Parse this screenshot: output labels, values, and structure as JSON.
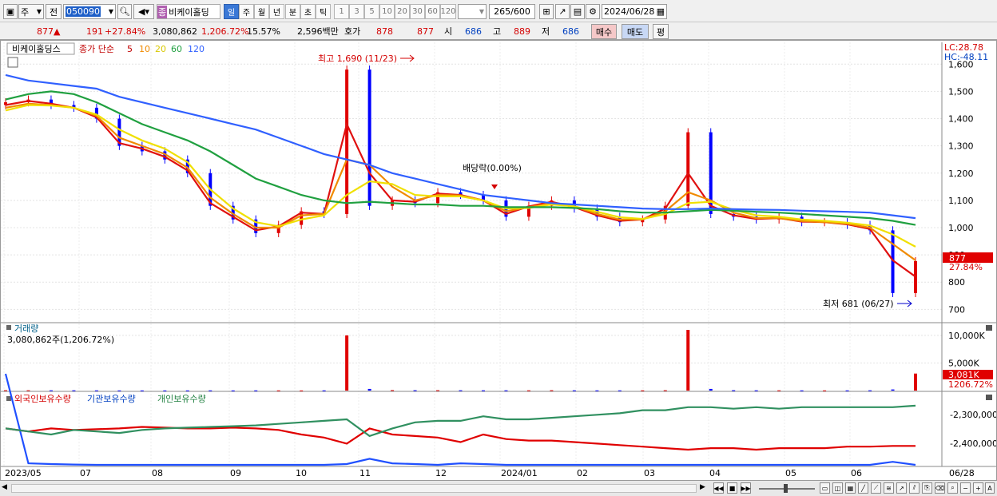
{
  "toolbar": {
    "period_combo": "주",
    "prev_label": "전",
    "code": "050090",
    "search_icon": "search-icon",
    "jong": "종",
    "stock_name": "비케이홀딩",
    "periods": [
      "일",
      "주",
      "월",
      "년",
      "분",
      "초",
      "틱"
    ],
    "minutes": [
      "1",
      "3",
      "5",
      "10",
      "20",
      "30",
      "60",
      "120"
    ],
    "count": "265",
    "count_total": "/600",
    "date": "2024/06/28"
  },
  "quote": {
    "price": "877",
    "arrow": "▲",
    "change": "191",
    "change_pct": "+27.84%",
    "volume": "3,080,862",
    "volume_pct": "1,206.72%",
    "turnover": "15.57%",
    "amount": "2,596백만",
    "hoga_label": "호가",
    "ask": "878",
    "bid": "877",
    "open_label": "시",
    "open": "686",
    "high_label": "고",
    "high": "889",
    "low_label": "저",
    "low": "686",
    "buy": "매수",
    "sell": "매도",
    "eval": "평"
  },
  "price_panel": {
    "name": "비케이홀딩스",
    "ma_label": "종가 단순",
    "ma_periods": [
      "5",
      "10",
      "20",
      "60",
      "120"
    ],
    "lc": "LC:28.78",
    "hc": "HC:-48.11",
    "high_note": "최고 1,690 (11/23)",
    "low_note": "최저 681 (06/27)",
    "dividend_note": "배당락(0.00%)",
    "last_price": "877",
    "last_pct": "27.84%"
  },
  "volume_panel": {
    "title": "거래량",
    "value": "3,080,862주(1,206.72%)",
    "last": "3,081K",
    "last_pct": "1206.72%"
  },
  "holdings_panel": {
    "foreign": "외국인보유수량",
    "institution": "기관보유수량",
    "individual": "개인보유수량"
  },
  "colors": {
    "up": "#e00000",
    "down": "#0000ff",
    "ma5": "#e01010",
    "ma10": "#f08a00",
    "ma20": "#f0e000",
    "ma60": "#20a040",
    "ma120": "#3060ff"
  },
  "chart_data": [
    {
      "type": "line",
      "title": "비케이홀딩스",
      "x_ticks": [
        "2023/05",
        "07",
        "08",
        "09",
        "10",
        "11",
        "12",
        "2024/01",
        "02",
        "03",
        "04",
        "05",
        "06",
        "06/28"
      ],
      "y_ticks": [
        1600,
        1500,
        1400,
        1300,
        1200,
        1100,
        1000,
        900,
        800,
        700
      ],
      "ylim": [
        660,
        1680
      ],
      "series": [
        {
          "name": "종가",
          "values": [
            1460,
            1470,
            1450,
            1440,
            1400,
            1300,
            1280,
            1250,
            1200,
            1080,
            1030,
            980,
            1010,
            1060,
            1050,
            1580,
            1080,
            1100,
            1090,
            1130,
            1120,
            1100,
            1040,
            1080,
            1100,
            1070,
            1040,
            1020,
            1030,
            1080,
            1350,
            1050,
            1040,
            1030,
            1040,
            1020,
            1020,
            1010,
            990,
            760,
            877
          ]
        },
        {
          "name": "5",
          "values": [
            1450,
            1465,
            1455,
            1440,
            1405,
            1310,
            1290,
            1260,
            1210,
            1090,
            1040,
            990,
            1005,
            1055,
            1050,
            1380,
            1200,
            1100,
            1095,
            1125,
            1120,
            1100,
            1050,
            1078,
            1095,
            1075,
            1045,
            1025,
            1030,
            1070,
            1200,
            1080,
            1045,
            1032,
            1035,
            1022,
            1020,
            1012,
            995,
            880,
            820
          ]
        },
        {
          "name": "10",
          "values": [
            1440,
            1455,
            1450,
            1440,
            1410,
            1330,
            1300,
            1270,
            1220,
            1110,
            1050,
            1000,
            1000,
            1045,
            1050,
            1250,
            1230,
            1150,
            1100,
            1120,
            1118,
            1100,
            1060,
            1075,
            1090,
            1078,
            1050,
            1030,
            1030,
            1060,
            1130,
            1100,
            1055,
            1035,
            1035,
            1024,
            1020,
            1014,
            1000,
            940,
            880
          ]
        },
        {
          "name": "20",
          "values": [
            1430,
            1450,
            1448,
            1440,
            1415,
            1360,
            1320,
            1290,
            1240,
            1140,
            1070,
            1020,
            1005,
            1030,
            1045,
            1120,
            1170,
            1160,
            1120,
            1115,
            1115,
            1100,
            1070,
            1072,
            1085,
            1078,
            1058,
            1038,
            1032,
            1050,
            1090,
            1095,
            1065,
            1045,
            1040,
            1030,
            1025,
            1018,
            1008,
            975,
            930
          ]
        },
        {
          "name": "60",
          "values": [
            1470,
            1490,
            1500,
            1490,
            1460,
            1420,
            1380,
            1350,
            1320,
            1280,
            1230,
            1180,
            1150,
            1120,
            1100,
            1090,
            1095,
            1090,
            1085,
            1085,
            1080,
            1080,
            1075,
            1075,
            1075,
            1072,
            1068,
            1060,
            1055,
            1055,
            1060,
            1065,
            1062,
            1058,
            1055,
            1050,
            1045,
            1040,
            1035,
            1025,
            1010
          ]
        },
        {
          "name": "120",
          "values": [
            1560,
            1540,
            1530,
            1520,
            1510,
            1480,
            1460,
            1440,
            1420,
            1400,
            1380,
            1360,
            1330,
            1300,
            1270,
            1250,
            1230,
            1200,
            1180,
            1160,
            1140,
            1120,
            1110,
            1100,
            1090,
            1085,
            1080,
            1075,
            1070,
            1068,
            1068,
            1070,
            1068,
            1066,
            1065,
            1062,
            1060,
            1058,
            1055,
            1045,
            1035
          ]
        }
      ]
    },
    {
      "type": "bar",
      "title": "거래량",
      "y_ticks": [
        "10,000K",
        "5,000K"
      ],
      "ylim": [
        0,
        11000
      ],
      "values_k": [
        60,
        50,
        40,
        40,
        30,
        20,
        20,
        20,
        20,
        30,
        20,
        30,
        30,
        20,
        30,
        10000,
        300,
        80,
        60,
        60,
        50,
        40,
        40,
        40,
        60,
        40,
        30,
        30,
        40,
        60,
        11000,
        300,
        60,
        40,
        40,
        30,
        30,
        30,
        40,
        200,
        3081
      ]
    },
    {
      "type": "line",
      "title": "보유수량",
      "y_ticks": [
        "-2,300,000",
        "-2,400,000"
      ],
      "series": [
        {
          "name": "외국인보유수량",
          "values": [
            560,
            580,
            560,
            570,
            565,
            560,
            550,
            555,
            560,
            560,
            555,
            560,
            570,
            600,
            620,
            660,
            560,
            600,
            610,
            620,
            650,
            600,
            630,
            640,
            640,
            650,
            660,
            670,
            680,
            690,
            700,
            690,
            690,
            700,
            690,
            690,
            690,
            680,
            680,
            675,
            675
          ]
        },
        {
          "name": "기관보유수량",
          "values": [
            200,
            790,
            795,
            798,
            800,
            800,
            800,
            800,
            800,
            800,
            800,
            800,
            800,
            800,
            800,
            795,
            760,
            790,
            795,
            800,
            790,
            795,
            800,
            800,
            800,
            800,
            800,
            800,
            800,
            800,
            800,
            800,
            800,
            800,
            800,
            800,
            800,
            800,
            800,
            780,
            800
          ]
        },
        {
          "name": "개인보유수량",
          "values": [
            560,
            580,
            600,
            570,
            580,
            590,
            570,
            560,
            555,
            550,
            545,
            540,
            530,
            520,
            510,
            500,
            610,
            560,
            520,
            510,
            510,
            480,
            500,
            500,
            490,
            480,
            470,
            460,
            440,
            440,
            420,
            420,
            430,
            420,
            430,
            420,
            420,
            420,
            420,
            420,
            410
          ]
        }
      ]
    }
  ]
}
